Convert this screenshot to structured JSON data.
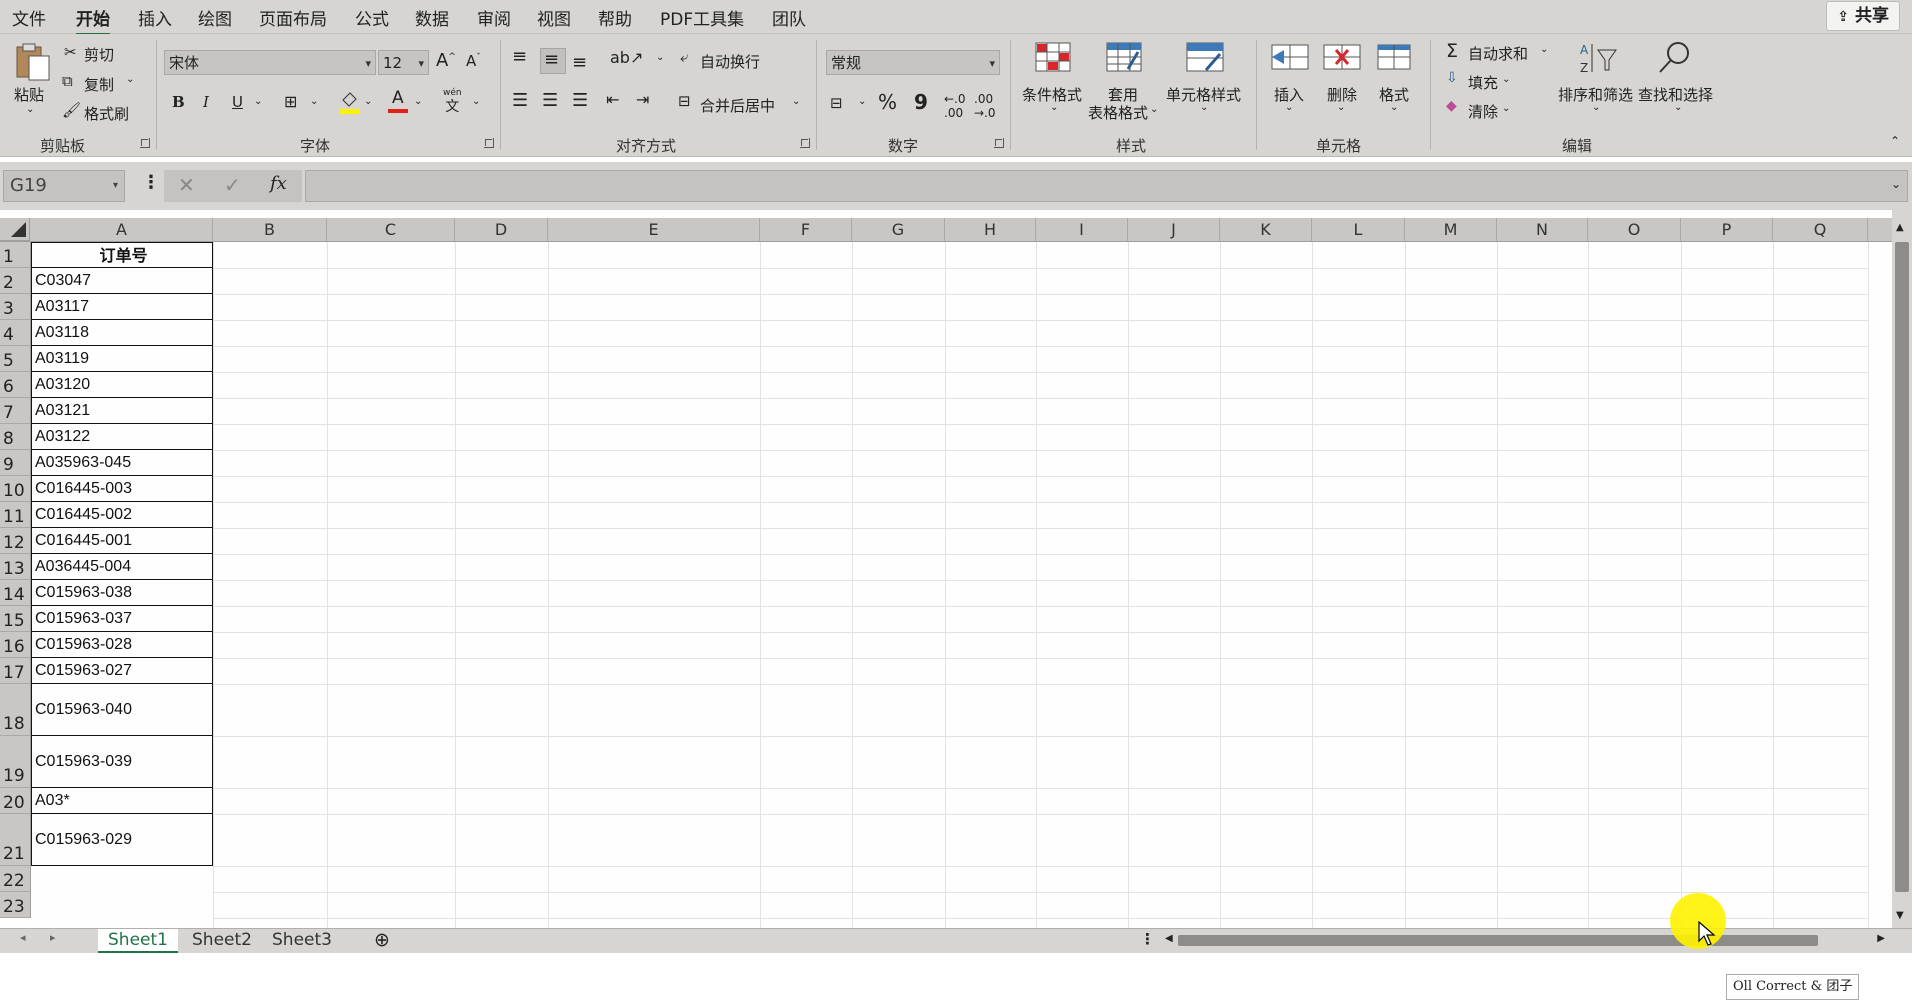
{
  "menu": {
    "items": [
      "文件",
      "开始",
      "插入",
      "绘图",
      "页面布局",
      "公式",
      "数据",
      "审阅",
      "视图",
      "帮助",
      "PDF工具集",
      "团队"
    ],
    "active": "开始",
    "share_label": "共享"
  },
  "ribbon": {
    "clipboard": {
      "paste": "粘贴",
      "cut": "剪切",
      "copy": "复制",
      "format_painter": "格式刷",
      "group_label": "剪贴板"
    },
    "font": {
      "font_name": "宋体",
      "font_size": "12",
      "bold": "B",
      "italic": "I",
      "underline": "U",
      "phonetic": "wén",
      "group_label": "字体"
    },
    "alignment": {
      "wrap_text": "自动换行",
      "merge_center": "合并后居中",
      "group_label": "对齐方式"
    },
    "number": {
      "format": "常规",
      "percent": "%",
      "comma": "9",
      "group_label": "数字"
    },
    "styles": {
      "conditional": "条件格式",
      "table_line1": "套用",
      "table_line2": "表格格式",
      "cell_styles": "单元格样式",
      "group_label": "样式"
    },
    "cells": {
      "insert": "插入",
      "delete": "删除",
      "format": "格式",
      "group_label": "单元格"
    },
    "editing": {
      "autosum": "自动求和",
      "fill": "填充",
      "clear": "清除",
      "sort_filter": "排序和筛选",
      "find_select": "查找和选择",
      "group_label": "编辑"
    }
  },
  "formula_bar": {
    "name_box": "G19",
    "fx": "fx",
    "value": ""
  },
  "columns": [
    "A",
    "B",
    "C",
    "D",
    "E",
    "F",
    "G",
    "H",
    "I",
    "J",
    "K",
    "L",
    "M",
    "N",
    "O",
    "P",
    "Q"
  ],
  "rows": [
    "1",
    "2",
    "3",
    "4",
    "5",
    "6",
    "7",
    "8",
    "9",
    "10",
    "11",
    "12",
    "13",
    "14",
    "15",
    "16",
    "17",
    "18",
    "19",
    "20",
    "21",
    "22",
    "23"
  ],
  "column_a": [
    "订单号",
    "C03047",
    "A03117",
    "A03118",
    "A03119",
    "A03120",
    "A03121",
    "A03122",
    "A035963-045",
    "C016445-003",
    "C016445-002",
    "C016445-001",
    "A036445-004",
    "C015963-038",
    "C015963-037",
    "C015963-028",
    "C015963-027",
    "C015963-040",
    "C015963-039",
    "A03*",
    "C015963-029"
  ],
  "sheets": [
    "Sheet1",
    "Sheet2",
    "Sheet3"
  ],
  "active_sheet": "Sheet1",
  "watermark": "Oll Correct & 团子",
  "colors": {
    "accent": "#217346",
    "ribbon_bg": "#d6d5d2",
    "cursor_highlight": "#fff200"
  }
}
